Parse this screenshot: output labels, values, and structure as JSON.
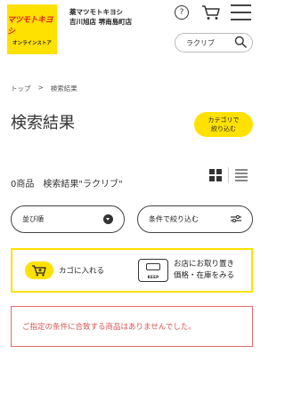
{
  "header": {
    "logo_brand": "マツモトキヨシ",
    "logo_sub": "オンラインストア",
    "store_line1": "薬マツモトキヨシ",
    "store_line2": "吉川旭店 堺南島町店",
    "help_label": "?",
    "search_value": "ラクリブ"
  },
  "breadcrumb": {
    "home": "トップ",
    "sep": ">",
    "current": "検索結果"
  },
  "page_title": "検索結果",
  "category_button": {
    "line1": "カテゴリで",
    "line2": "絞り込む"
  },
  "result_count": "0商品　検索結果\"ラクリブ\"",
  "sort_label": "並び順",
  "filter_label": "条件で絞り込む",
  "promo": {
    "cart_text": "カゴに入れる",
    "keep_badge": "KEEP",
    "store_line1": "お店にお取り置き",
    "store_line2": "価格・在庫をみる"
  },
  "empty_message": "ご指定の条件に合致する商品はありませんでした。",
  "colors": {
    "accent": "#ffe100",
    "error": "#d9534f"
  }
}
